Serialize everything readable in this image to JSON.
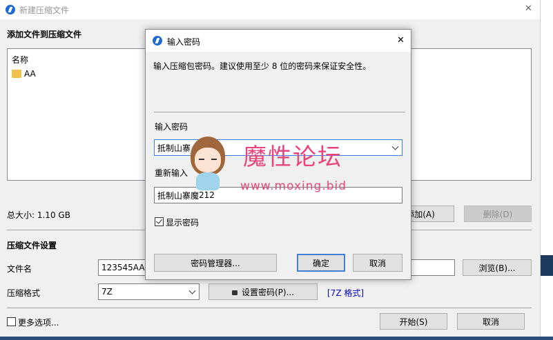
{
  "main_window": {
    "title": "新建压缩文件",
    "close_glyph": "✕",
    "section_add": "添加文件到压缩文件",
    "file_list": {
      "column_header": "名称",
      "items": [
        "AA"
      ]
    },
    "total_size": "总大小: 1.10 GB",
    "add_button": "添加(A)",
    "delete_button": "删除(D)",
    "section_settings": "压缩文件设置",
    "filename_label": "文件名",
    "filename_value": "123545AAA",
    "browse_button": "浏览(B)...",
    "format_label": "压缩格式",
    "format_value": "7Z",
    "set_password_button": "设置密码(P)...",
    "format_link": "[7Z 格式]",
    "more_options_label": "更多选项...",
    "start_button": "开始(S)",
    "cancel_button": "取消"
  },
  "password_dialog": {
    "title": "输入密码",
    "close_glyph": "✕",
    "description": "输入压缩包密码。建议使用至少 8 位的密码来保证安全性。",
    "password_label": "输入密码",
    "password_value": "抵制山寨",
    "reenter_label": "重新输入",
    "reenter_value": "抵制山寨魔",
    "reenter_suffix": "212",
    "show_password_label": "显示密码",
    "show_password_checked": true,
    "manager_button": "密码管理器...",
    "ok_button": "确定",
    "cancel_button": "取消"
  },
  "watermark": {
    "title": "魔性论坛",
    "url": "www.moxing.bid"
  },
  "colors": {
    "accent": "#3c7fd8",
    "link": "#0000cc",
    "watermark": "#e8457b",
    "folder": "#f0c14b"
  }
}
